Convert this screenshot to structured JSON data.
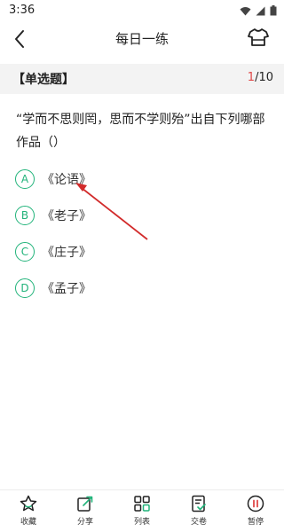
{
  "status": {
    "time": "3:36"
  },
  "header": {
    "title": "每日一练"
  },
  "question_header": {
    "type_label": "【单选题】",
    "current": "1",
    "total": "/10"
  },
  "question": {
    "text": "“学而不思则罔，思而不学则殆”出自下列哪部作品（）"
  },
  "options": [
    {
      "letter": "A",
      "text": "《论语》"
    },
    {
      "letter": "B",
      "text": "《老子》"
    },
    {
      "letter": "C",
      "text": "《庄子》"
    },
    {
      "letter": "D",
      "text": "《孟子》"
    }
  ],
  "bottom_tabs": [
    {
      "label": "收藏",
      "icon": "star-icon"
    },
    {
      "label": "分享",
      "icon": "share-icon"
    },
    {
      "label": "列表",
      "icon": "grid-icon"
    },
    {
      "label": "交卷",
      "icon": "submit-icon"
    },
    {
      "label": "暂停",
      "icon": "pause-icon"
    }
  ],
  "colors": {
    "accent": "#21b37a",
    "highlight": "#e04848",
    "annotation_arrow": "#d22b2b"
  }
}
